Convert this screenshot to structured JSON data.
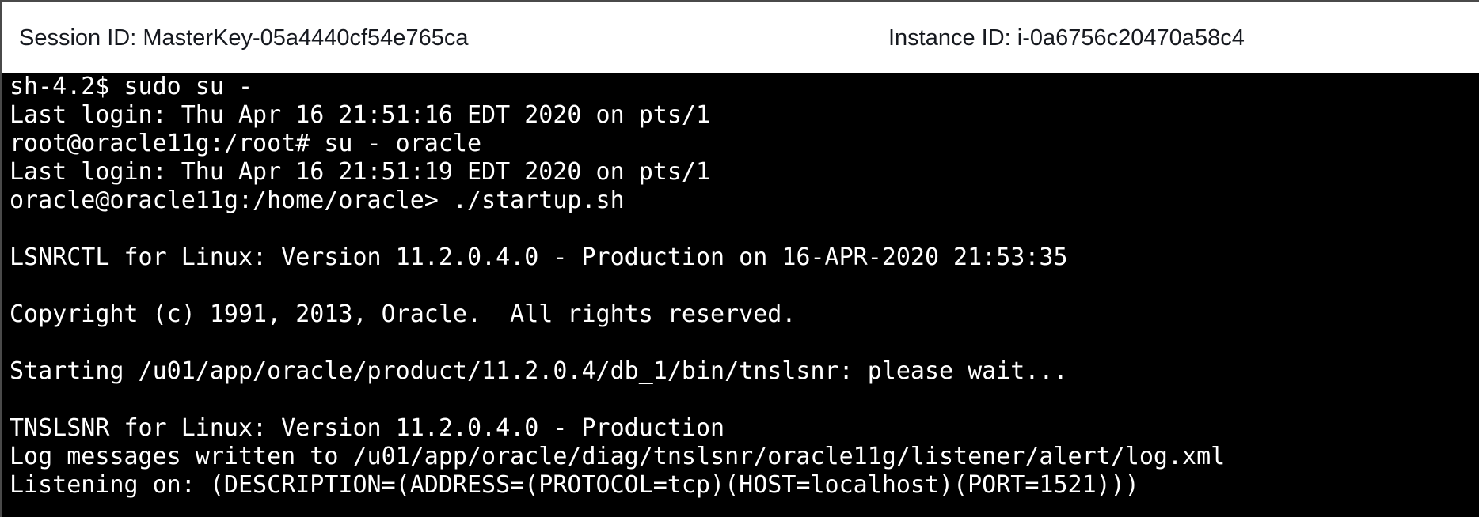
{
  "session": {
    "session_id_label": "Session ID: MasterKey-05a4440cf54e765ca",
    "instance_id_label": "Instance ID: i-0a6756c20470a58c4"
  },
  "terminal": {
    "lines": [
      "sh-4.2$ sudo su -",
      "Last login: Thu Apr 16 21:51:16 EDT 2020 on pts/1",
      "root@oracle11g:/root# su - oracle",
      "Last login: Thu Apr 16 21:51:19 EDT 2020 on pts/1",
      "oracle@oracle11g:/home/oracle> ./startup.sh",
      "",
      "LSNRCTL for Linux: Version 11.2.0.4.0 - Production on 16-APR-2020 21:53:35",
      "",
      "Copyright (c) 1991, 2013, Oracle.  All rights reserved.",
      "",
      "Starting /u01/app/oracle/product/11.2.0.4/db_1/bin/tnslsnr: please wait...",
      "",
      "TNSLSNR for Linux: Version 11.2.0.4.0 - Production",
      "Log messages written to /u01/app/oracle/diag/tnslsnr/oracle11g/listener/alert/log.xml",
      "Listening on: (DESCRIPTION=(ADDRESS=(PROTOCOL=tcp)(HOST=localhost)(PORT=1521)))"
    ]
  }
}
